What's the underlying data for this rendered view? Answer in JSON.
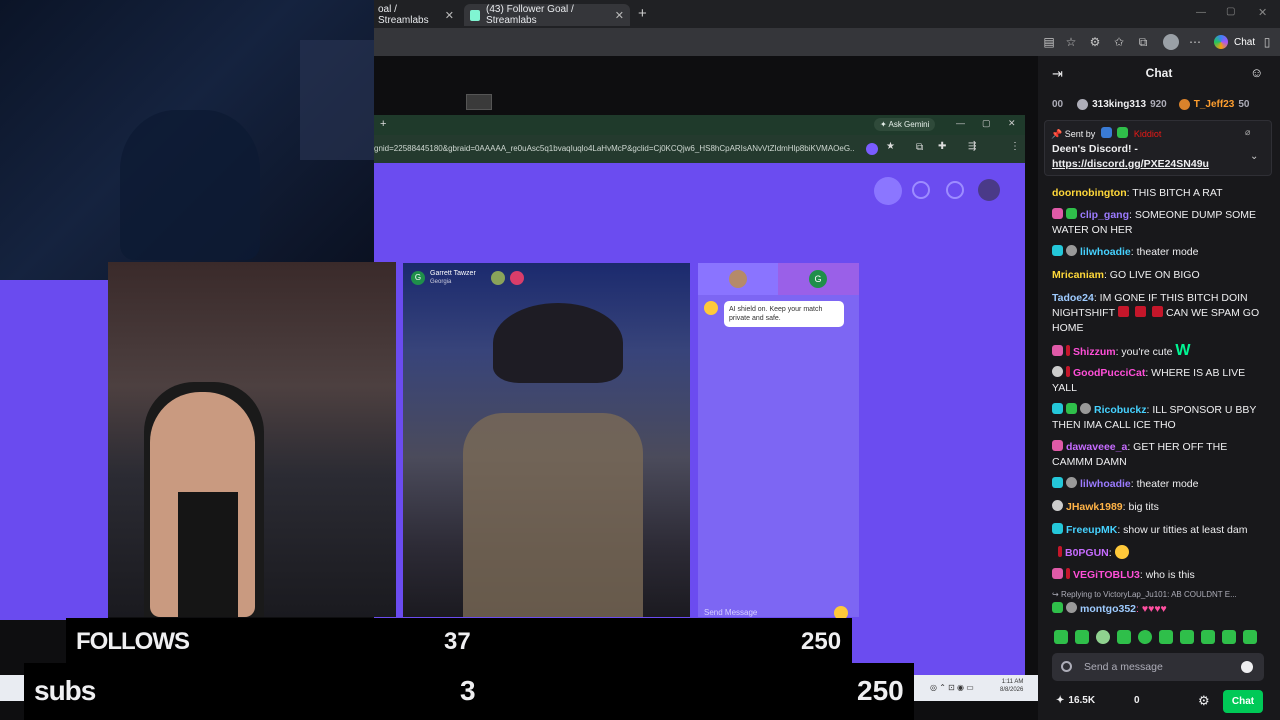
{
  "browser": {
    "tabs": [
      {
        "label": "oal / Streamlabs"
      },
      {
        "label": "(43) Follower Goal / Streamlabs"
      }
    ],
    "chat_button": "Chat"
  },
  "inner_browser": {
    "ask_gemini": "Ask Gemini",
    "url": "gnid=22588445180&gbraid=0AAAAA_re0uAsc5q1bvaqIuqlo4LaHvMcP&gclid=Cj0KCQjw6_HS8hCpARIsANvVtZIdmHlp8biKVMAOeG...",
    "partner_name": "Garrett Tawzer",
    "partner_location": "Georgia",
    "ai_shield": "AI shield on. Keep your match private and safe.",
    "send_message_placeholder": "Send Message",
    "g_avatar": "G",
    "taskbar_time": "1:11 AM",
    "taskbar_date": "8/8/2026"
  },
  "overlay": {
    "follows_label": "FOLLOWS",
    "follows_value": "37",
    "follows_goal": "250",
    "subs_label": "subs",
    "subs_value": "3",
    "subs_goal": "250"
  },
  "chat": {
    "header_title": "Chat",
    "leaderboard": [
      {
        "rank": "00",
        "name": "",
        "score": ""
      },
      {
        "rank": "",
        "name": "313king313",
        "score": "920"
      },
      {
        "rank": "",
        "name": "T_Jeff23",
        "score": "50"
      }
    ],
    "pinned_sent_by": "Sent by",
    "pinned_user": "Kiddiot",
    "pinned_text": "Deen's Discord! -",
    "pinned_link": "https://discord.gg/PXE24SN49u",
    "messages": [
      {
        "user": "doornobington",
        "color": "#ffd83a",
        "text": ": THIS BITCH A RAT"
      },
      {
        "user": "clip_gang",
        "color": "#ff4fd8",
        "text": ": SOMEONE DUMP SOME WATER ON HER"
      },
      {
        "user": "lilwhoadie",
        "color": "#9b7bff",
        "text": ": theater mode"
      },
      {
        "user": "Mricaniam",
        "color": "#ffd83a",
        "text": ": GO LIVE ON BIGO"
      },
      {
        "user": "Tadoe24",
        "color": "#9ecbff",
        "text": ": IM GONE IF THIS BITCH DOIN NIGHTSHIFT"
      },
      {
        "user": "",
        "color": "",
        "text": "CAN WE SPAM GO HOME"
      },
      {
        "user": "Shizzum",
        "color": "#ff4fd8",
        "text": ": you're cute"
      },
      {
        "user": "GoodPucciCat",
        "color": "#ff4fd8",
        "text": ": WHERE IS AB LIVE YALL"
      },
      {
        "user": "Ricobuckz",
        "color": "#46d2ff",
        "text": ": ILL SPONSOR U BBY THEN IMA CALL ICE THO"
      },
      {
        "user": "dawaveee_a",
        "color": "#ff4fd8",
        "text": ": GET HER OFF THE CAMMM DAMN"
      },
      {
        "user": "lilwhoadie",
        "color": "#9b7bff",
        "text": ": theater mode"
      },
      {
        "user": "JHawk1989",
        "color": "#ffb347",
        "text": ": big tits"
      },
      {
        "user": "FreeupMK",
        "color": "#46d2ff",
        "text": ": show ur titties at least dam"
      },
      {
        "user": "B0PGUN",
        "color": "#c66bff",
        "text": ":"
      },
      {
        "user": "VEGiTOBLU3",
        "color": "#ff4fd8",
        "text": ": who is this"
      }
    ],
    "reply_to": "Replying to VictoryLap_Ju101: AB COULDNT E...",
    "last_user": "montgo352",
    "send_placeholder": "Send a message",
    "viewer_count": "16.5K",
    "points": "0",
    "chat_button": "Chat",
    "emote_w": "W"
  },
  "colors": {
    "accent_green": "#00f593",
    "purple": "#6b4cf0",
    "twitch_bg": "#18181b"
  }
}
